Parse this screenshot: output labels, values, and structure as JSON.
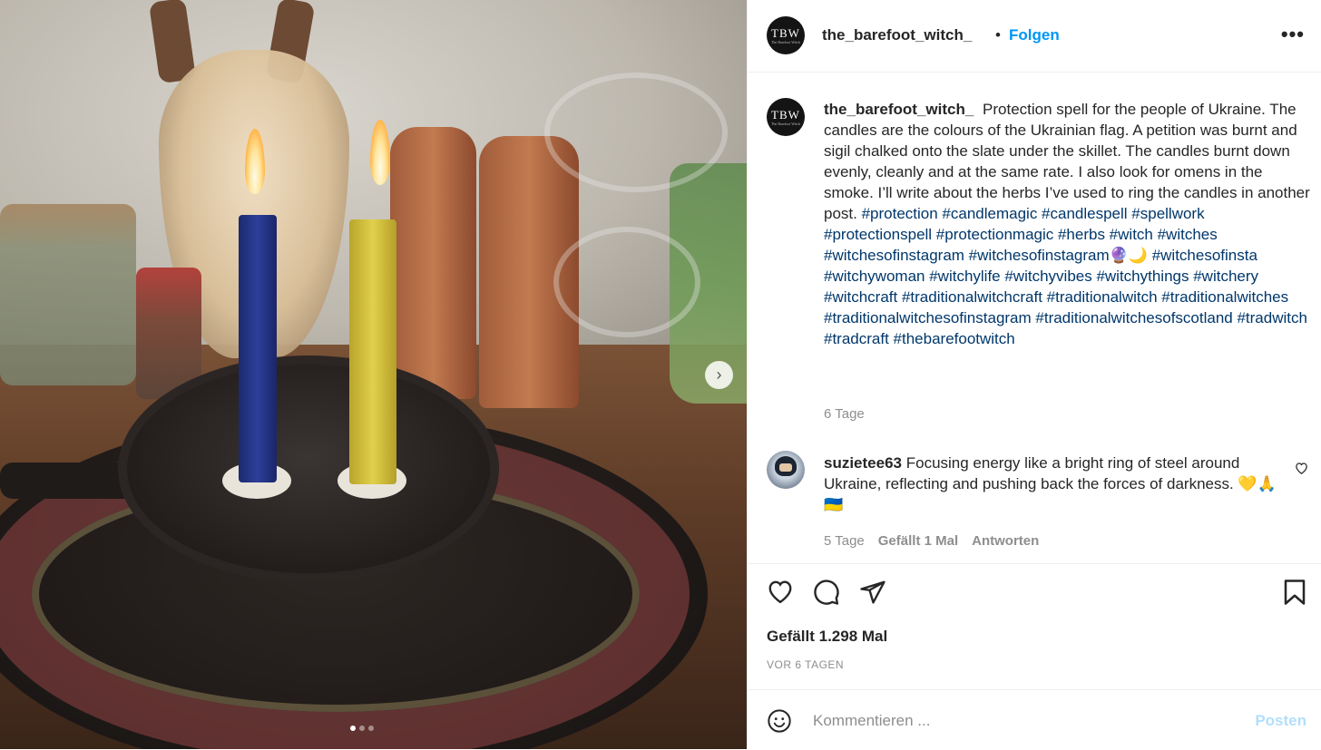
{
  "header": {
    "avatar_text": "TBW",
    "avatar_subtext": "The Barefoot Witch",
    "username": "the_barefoot_witch_",
    "separator": "•",
    "follow_label": "Folgen",
    "more_label": "•••"
  },
  "caption": {
    "username": "the_barefoot_witch_",
    "text": "Protection spell for the people of Ukraine. The candles are the colours of the Ukrainian flag. A petition was burnt and sigil chalked onto the slate under the skillet. The candles burnt down evenly, cleanly and at the same rate. I also look for omens in the smoke. I’ll write about the herbs I’ve used to ring the candles in another post.",
    "hashtags": "#protection #candlemagic #candlespell #spellwork #protectionspell #protectionmagic #herbs #witch #witches #witchesofinstagram #witchesofinstagram🔮🌙 #witchesofinsta #witchywoman #witchylife #witchyvibes #witchythings #witchery #witchcraft #traditionalwitchcraft #traditionalwitch #traditionalwitches #traditionalwitchesofinstagram #traditionalwitchesofscotland #tradwitch #tradcraft #thebarefootwitch",
    "time": "6 Tage"
  },
  "comment": {
    "username": "suzietee63",
    "text": "Focusing energy like a bright ring of steel around Ukraine, reflecting and pushing back the forces of darkness. 💛🙏🇺🇦",
    "time": "5 Tage",
    "likes": "Gefällt 1 Mal",
    "reply_label": "Antworten"
  },
  "actions": {
    "like_icon": "heart-icon",
    "comment_icon": "comment-icon",
    "share_icon": "paper-plane-icon",
    "save_icon": "bookmark-icon"
  },
  "likes_text": "Gefällt 1.298 Mal",
  "age_text": "VOR 6 TAGEN",
  "composer": {
    "placeholder": "Kommentieren ...",
    "post_label": "Posten"
  },
  "media": {
    "next_icon": "chevron-right-icon",
    "carousel_total": 3,
    "carousel_active": 1
  },
  "colors": {
    "link_blue": "#0095f6",
    "hashtag": "#00376b",
    "post_disabled": "#b2dffc",
    "muted": "#8e8e8e"
  }
}
